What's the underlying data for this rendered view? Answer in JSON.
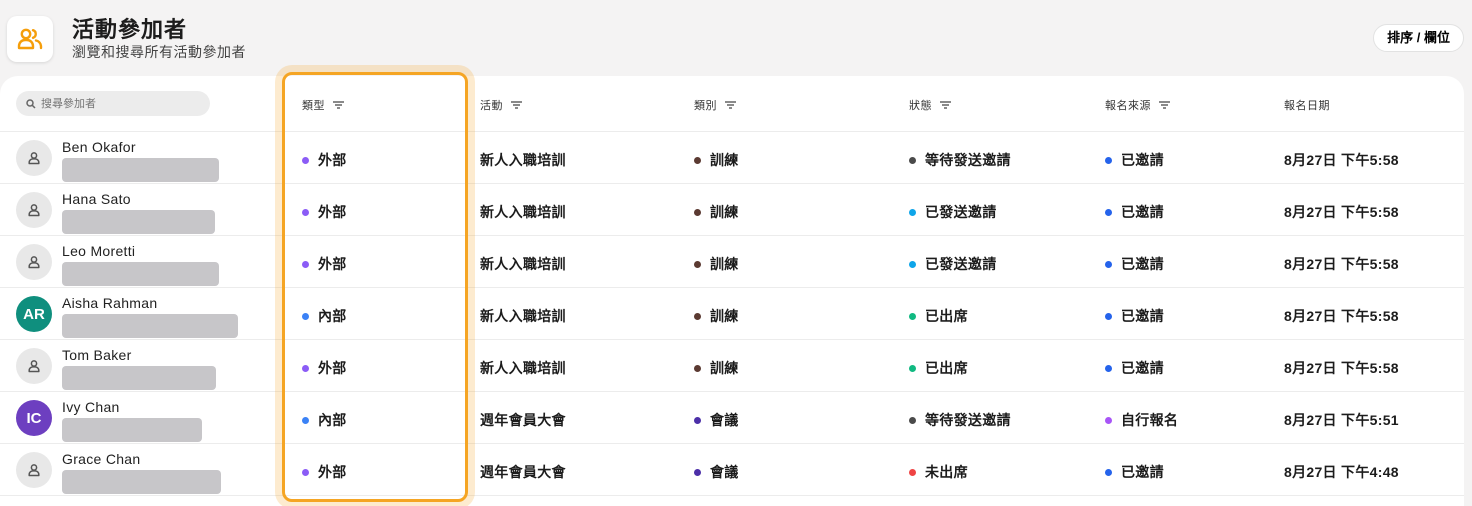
{
  "header": {
    "title": "活動參加者",
    "subtitle": "瀏覽和搜尋所有活動參加者",
    "sort_button": "排序 / 欄位"
  },
  "search": {
    "placeholder": "搜尋參加者"
  },
  "columns": [
    "類型",
    "活動",
    "類別",
    "狀態",
    "報名來源",
    "報名日期"
  ],
  "colors": {
    "accent": "#f5a524",
    "external": "#8b5cf6",
    "internal": "#3b82f6",
    "training": "#5b3a32",
    "meeting": "#4c2fa8",
    "pending": "#4a4a4a",
    "sent": "#0ea5e9",
    "attended": "#10b981",
    "absent": "#ef4444",
    "invited": "#2563eb",
    "self": "#a855f7"
  },
  "rows": [
    {
      "name": "Ben Okafor",
      "initials": "",
      "avatar_color": "",
      "type": "外部",
      "type_color": "#8b5cf6",
      "event": "新人入職培訓",
      "category": "訓練",
      "category_color": "#5b3a32",
      "status": "等待發送邀請",
      "status_color": "#4a4a4a",
      "source": "已邀請",
      "source_color": "#2563eb",
      "date": "8月27日 下午5:58"
    },
    {
      "name": "Hana Sato",
      "initials": "",
      "avatar_color": "",
      "type": "外部",
      "type_color": "#8b5cf6",
      "event": "新人入職培訓",
      "category": "訓練",
      "category_color": "#5b3a32",
      "status": "已發送邀請",
      "status_color": "#0ea5e9",
      "source": "已邀請",
      "source_color": "#2563eb",
      "date": "8月27日 下午5:58"
    },
    {
      "name": "Leo Moretti",
      "initials": "",
      "avatar_color": "",
      "type": "外部",
      "type_color": "#8b5cf6",
      "event": "新人入職培訓",
      "category": "訓練",
      "category_color": "#5b3a32",
      "status": "已發送邀請",
      "status_color": "#0ea5e9",
      "source": "已邀請",
      "source_color": "#2563eb",
      "date": "8月27日 下午5:58"
    },
    {
      "name": "Aisha Rahman",
      "initials": "AR",
      "avatar_color": "#0f8f7e",
      "type": "內部",
      "type_color": "#3b82f6",
      "event": "新人入職培訓",
      "category": "訓練",
      "category_color": "#5b3a32",
      "status": "已出席",
      "status_color": "#10b981",
      "source": "已邀請",
      "source_color": "#2563eb",
      "date": "8月27日 下午5:58"
    },
    {
      "name": "Tom Baker",
      "initials": "",
      "avatar_color": "",
      "type": "外部",
      "type_color": "#8b5cf6",
      "event": "新人入職培訓",
      "category": "訓練",
      "category_color": "#5b3a32",
      "status": "已出席",
      "status_color": "#10b981",
      "source": "已邀請",
      "source_color": "#2563eb",
      "date": "8月27日 下午5:58"
    },
    {
      "name": "Ivy Chan",
      "initials": "IC",
      "avatar_color": "#6d3fc0",
      "type": "內部",
      "type_color": "#3b82f6",
      "event": "週年會員大會",
      "category": "會議",
      "category_color": "#4c2fa8",
      "status": "等待發送邀請",
      "status_color": "#4a4a4a",
      "source": "自行報名",
      "source_color": "#a855f7",
      "date": "8月27日 下午5:51"
    },
    {
      "name": "Grace Chan",
      "initials": "",
      "avatar_color": "",
      "type": "外部",
      "type_color": "#8b5cf6",
      "event": "週年會員大會",
      "category": "會議",
      "category_color": "#4c2fa8",
      "status": "未出席",
      "status_color": "#ef4444",
      "source": "已邀請",
      "source_color": "#2563eb",
      "date": "8月27日 下午4:48"
    }
  ]
}
